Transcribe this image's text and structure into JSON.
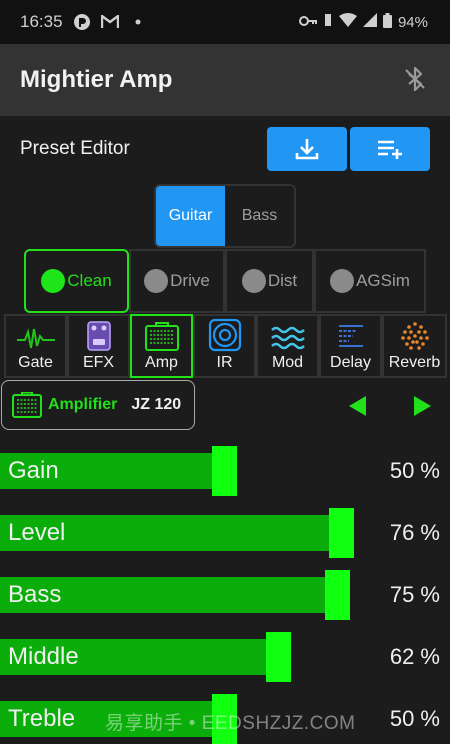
{
  "status_bar": {
    "time": "16:35",
    "battery": "94%"
  },
  "app": {
    "title": "Mightier Amp"
  },
  "preset": {
    "label": "Preset Editor"
  },
  "instrument": {
    "options": [
      "Guitar",
      "Bass"
    ],
    "selected": "Guitar"
  },
  "channels": {
    "items": [
      "Clean",
      "Drive",
      "Dist",
      "AGSim"
    ],
    "selected": "Clean"
  },
  "effects": {
    "items": [
      "Gate",
      "EFX",
      "Amp",
      "IR",
      "Mod",
      "Delay",
      "Reverb"
    ],
    "selected": "Amp"
  },
  "module": {
    "label": "Amplifier",
    "model": "JZ 120"
  },
  "params": [
    {
      "name": "Gain",
      "value": "50 %",
      "level": 50
    },
    {
      "name": "Level",
      "value": "76 %",
      "level": 76
    },
    {
      "name": "Bass",
      "value": "75 %",
      "level": 75
    },
    {
      "name": "Middle",
      "value": "62 %",
      "level": 62
    },
    {
      "name": "Treble",
      "value": "50 %",
      "level": 50
    }
  ],
  "watermark": "易享助手 • EEDSHZJZ.COM",
  "colors": {
    "accent_green": "#22e01a",
    "bar_green": "#0aad0a",
    "thumb_green": "#11ff11",
    "blue": "#2196f3"
  }
}
